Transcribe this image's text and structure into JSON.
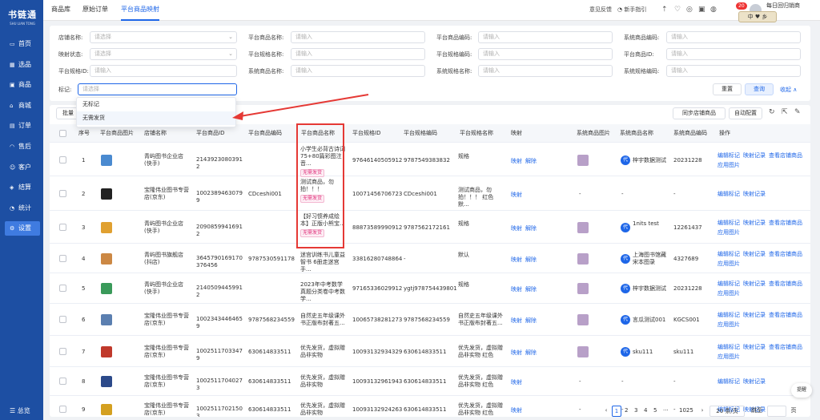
{
  "app": {
    "logo": "书链通",
    "logo_sub": "SHU LIAN TONG"
  },
  "sidebar": {
    "items": [
      {
        "label": "首页",
        "icon": "monitor-icon"
      },
      {
        "label": "选品",
        "icon": "grid-icon"
      },
      {
        "label": "商品",
        "icon": "box-icon"
      },
      {
        "label": "商城",
        "icon": "store-icon"
      },
      {
        "label": "订单",
        "icon": "order-icon"
      },
      {
        "label": "售后",
        "icon": "headset-icon"
      },
      {
        "label": "客户",
        "icon": "users-icon"
      },
      {
        "label": "结算",
        "icon": "settle-icon"
      },
      {
        "label": "统计",
        "icon": "chart-icon"
      },
      {
        "label": "设置",
        "icon": "settings-icon"
      }
    ],
    "help": "总览"
  },
  "header": {
    "tabs": [
      "商品库",
      "原始订单",
      "平台商品映射"
    ],
    "feedback": "意见反馈",
    "guide": "新手指引",
    "badge": "20",
    "user_line": "每日回归销商",
    "ime": "中 ♥ 乡"
  },
  "filters": {
    "shop_name": {
      "label": "店铺名称:",
      "placeholder": "请选择"
    },
    "platform_product_name": {
      "label": "平台商品名称:",
      "placeholder": "请输入"
    },
    "platform_product_code": {
      "label": "平台商品编码:",
      "placeholder": "请输入"
    },
    "system_product_code": {
      "label": "系统商品编码:",
      "placeholder": "请输入"
    },
    "mapping_status": {
      "label": "映射状态:",
      "placeholder": "请选择"
    },
    "platform_spec_name": {
      "label": "平台规格名称:",
      "placeholder": "请输入"
    },
    "platform_spec_code": {
      "label": "平台规格编码:",
      "placeholder": "请输入"
    },
    "platform_product_id": {
      "label": "平台商品ID:",
      "placeholder": "请输入"
    },
    "platform_spec_id": {
      "label": "平台规格ID:",
      "placeholder": "请输入"
    },
    "system_product_name": {
      "label": "系统商品名称:",
      "placeholder": "请输入"
    },
    "system_spec_name": {
      "label": "系统规格名称:",
      "placeholder": "请输入"
    },
    "system_spec_code": {
      "label": "系统规格编码:",
      "placeholder": "请输入"
    },
    "mark": {
      "label": "标记:",
      "placeholder": "请选择"
    },
    "reset": "重置",
    "search": "查询",
    "collapse": "收起 ∧"
  },
  "dropdown": {
    "options": [
      "无标记",
      "无需发货"
    ]
  },
  "toolbar": {
    "batch": "批量",
    "sync": "同步店铺商品",
    "auto": "自动配置"
  },
  "columns": [
    "序号",
    "平台商品图片",
    "店铺名称",
    "平台商品ID",
    "平台商品编码",
    "平台商品名称",
    "平台规格ID",
    "平台规格编码",
    "平台规格名称",
    "映射",
    "系统商品图片",
    "系统商品名称",
    "系统商品编码",
    "操作"
  ],
  "rows": [
    {
      "no": "1",
      "shop": "青屿图书企业店(快手)",
      "pid": "21439230803912",
      "pcode": "",
      "pname": "小学生必背古诗词75+80篇彩图注音...",
      "tag": "无需发货",
      "sid": "97646140505912",
      "scode": "9787549383832",
      "sname": "规格",
      "map": [
        "映射",
        "解除"
      ],
      "sysimg": true,
      "sysname": "梓宇数据测试",
      "syscode": "20231228",
      "ops": [
        "编辑标记",
        "映射记录",
        "查看店铺商品",
        "应用图片"
      ]
    },
    {
      "no": "2",
      "shop": "宝隆伟业图书专营店(京东)",
      "pid": "10023894630799",
      "pcode": "CDceshi001",
      "pname": "测试商品，勿拍！！！",
      "tag": "无需发货",
      "sid": "10071456706723",
      "scode": "CDceshi001",
      "sname": "测试商品，勿拍！！！ 红色 默...",
      "map": [
        "映射"
      ],
      "sysimg": false,
      "sysname": "-",
      "syscode": "-",
      "ops": [
        "编辑标记",
        "映射记录"
      ]
    },
    {
      "no": "3",
      "shop": "青屿图书企业店(快手)",
      "pid": "20908599416912",
      "pcode": "",
      "pname": "【好习惯养成绘本】正版小熊宝...",
      "tag": "无需发货",
      "sid": "88873589990912",
      "scode": "9787562172161",
      "sname": "规格",
      "map": [
        "映射",
        "解除"
      ],
      "sysimg": true,
      "sysname": "1nits test",
      "syscode": "12261437",
      "ops": [
        "编辑标记",
        "映射记录",
        "查看店铺商品",
        "应用图片"
      ]
    },
    {
      "no": "4",
      "shop": "青屿图书旗舰店(抖店)",
      "pid": "3645790169170376456",
      "pcode": "9787530591178",
      "pname": "迷宫训练书儿童益智书 6册走迷宫手...",
      "tag": "",
      "sid": "3381628074886402",
      "scode": "-",
      "sname": "默认",
      "map": [
        "映射",
        "解除"
      ],
      "sysimg": true,
      "sysname": "上海图书馆藏宋本图录",
      "syscode": "4327689",
      "ops": [
        "编辑标记",
        "映射记录",
        "查看店铺商品",
        "应用图片"
      ]
    },
    {
      "no": "5",
      "shop": "青屿图书企业店(快手)",
      "pid": "21405094459912",
      "pcode": "",
      "pname": "2023年中考数学真题分类卷中考数学...",
      "tag": "",
      "sid": "97165336029912",
      "scode": "ygtj9787544398015",
      "sname": "规格",
      "map": [
        "映射",
        "解除"
      ],
      "sysimg": true,
      "sysname": "梓宇数据测试",
      "syscode": "20231228",
      "ops": [
        "编辑标记",
        "映射记录",
        "查看店铺商品",
        "应用图片"
      ]
    },
    {
      "no": "6",
      "shop": "宝隆伟业图书专营店(京东)",
      "pid": "10023434464659",
      "pcode": "9787568234559",
      "pname": "自然史五年级课外书正版布封著五...",
      "tag": "",
      "sid": "10065738281273",
      "scode": "9787568234559",
      "sname": "自然史五年级课外书正版布封著五...",
      "map": [
        "映射",
        "解除"
      ],
      "sysimg": true,
      "sysname": "言瓜测试001",
      "syscode": "KGCS001",
      "ops": [
        "编辑标记",
        "映射记录",
        "查看店铺商品",
        "应用图片"
      ]
    },
    {
      "no": "7",
      "shop": "宝隆伟业图书专营店(京东)",
      "pid": "10025117033479",
      "pcode": "630614833511",
      "pname": "优先发货，虚拟赠品非实物",
      "tag": "",
      "sid": "10093132934329",
      "scode": "630614833511",
      "sname": "优先发货，虚拟赠品非实物 红色",
      "map": [
        "映射",
        "解除"
      ],
      "sysimg": true,
      "sysname": "sku111",
      "syscode": "sku111",
      "ops": [
        "编辑标记",
        "映射记录",
        "查看店铺商品",
        "应用图片"
      ]
    },
    {
      "no": "8",
      "shop": "宝隆伟业图书专营店(京东)",
      "pid": "10025117040273",
      "pcode": "630614833511",
      "pname": "优先发货，虚拟赠品非实物",
      "tag": "",
      "sid": "10093132961943",
      "scode": "630614833511",
      "sname": "优先发货，虚拟赠品非实物 红色",
      "map": [
        "映射"
      ],
      "sysimg": false,
      "sysname": "-",
      "syscode": "-",
      "ops": [
        "编辑标记",
        "映射记录"
      ]
    },
    {
      "no": "9",
      "shop": "宝隆伟业图书专营店(京东)",
      "pid": "10025117021503",
      "pcode": "630614833511",
      "pname": "优先发货，虚拟赠品非实物",
      "tag": "",
      "sid": "10093132924263",
      "scode": "630614833511",
      "sname": "优先发货，虚拟赠品非实物 红色",
      "map": [
        "映射"
      ],
      "sysimg": false,
      "sysname": "-",
      "syscode": "-",
      "ops": [
        "编辑标记",
        "映射记录"
      ]
    }
  ],
  "pagination": {
    "pages": [
      "1",
      "2",
      "3",
      "4",
      "5",
      "···",
      "1025"
    ],
    "size": "20 条/页",
    "goto": "跳至",
    "page_unit": "页"
  },
  "float_btn": "提醒",
  "colors": {
    "primary": "#1e66e8",
    "sidebar": "#1d4fa3",
    "highlight": "#e53935",
    "tag": "#e0307a"
  }
}
